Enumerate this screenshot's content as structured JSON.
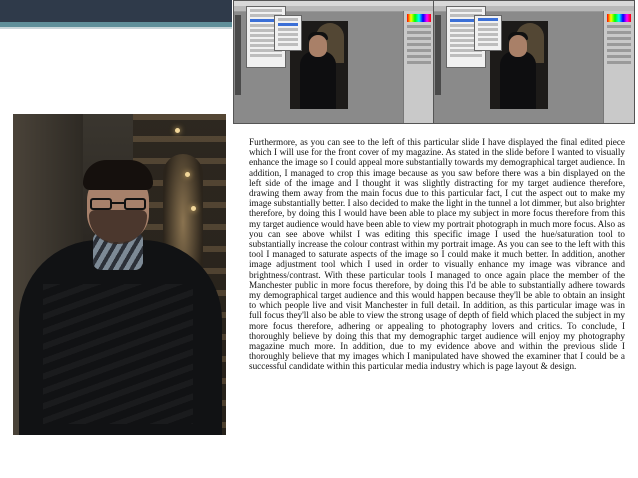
{
  "slide": {
    "header_colors": {
      "dark": "#2f3a4a",
      "accent": "#5f8f9a"
    }
  },
  "screenshots": [
    {
      "description_icon": "photoshop-hue-saturation-menu"
    },
    {
      "description_icon": "photoshop-brightness-contrast-menu"
    }
  ],
  "portrait": {
    "icon": "portrait-photo"
  },
  "body": {
    "paragraph": "Furthermore, as you can see to the left of this particular slide I have displayed the final edited piece which I will use for the front cover of my magazine. As stated in the slide before  I wanted to visually enhance the image so I could appeal more substantially towards my demographical target audience. In addition, I managed to crop this image because as you saw before there was a bin displayed on the left side of the image and I thought it was slightly distracting for my target audience therefore, drawing them away from the main focus due to this particular fact, I cut the aspect out to make my image substantially better. I also decided to make the light in the tunnel a lot dimmer, but also brighter therefore, by doing this I would have been able to place my subject in more focus therefore from this my target audience would have been able to view my portrait photograph in much more focus. Also as you can see above whilst I was editing this specific image I used the hue/saturation tool to substantially increase the colour contrast within my portrait image. As you can see to the left with this tool I managed to saturate aspects of the image so I could make it much better. In addition, another image adjustment tool which I used in order to visually enhance my image was vibrance and brightness/contrast. With these particular tools I managed to once again place the member of the Manchester public in more focus therefore, by doing this I'd be able to substantially adhere towards my demographical target audience and this would happen because they'll be able to obtain an insight to which people live and visit Manchester in full detail. In addition, as this particular image was in full focus they'll also be able to view the strong usage of depth of field which placed the subject in my more focus therefore, adhering or appealing to photography lovers and critics. To conclude, I thoroughly believe by doing this that my demographic target audience will enjoy my photography magazine much more.  In addition, due to  my evidence above and within the previous slide I thoroughly believe that my images which I manipulated have showed the examiner that I could be a successful candidate within this particular media industry which is page layout & design."
  }
}
